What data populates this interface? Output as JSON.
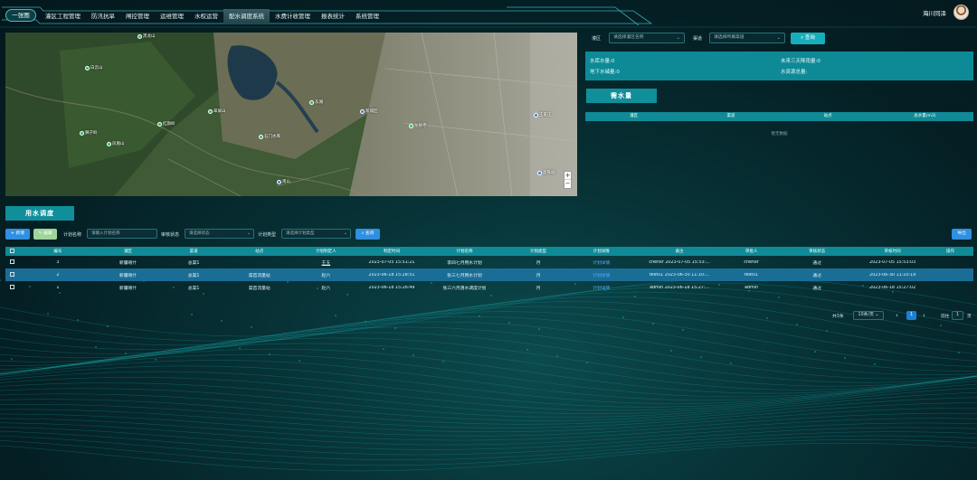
{
  "nav": {
    "home_label": "一张图",
    "items": [
      "灌区工程管理",
      "防汛抗旱",
      "闸控管理",
      "运维管理",
      "水权运营",
      "配水调度系统",
      "水费计收管理",
      "报表统计",
      "系统管理"
    ],
    "active_index": 5
  },
  "user": {
    "name": "海川同泽"
  },
  "map": {
    "labels": [
      "黑龙山",
      "白云山",
      "红旗岭",
      "狮子岭",
      "翠屏山",
      "凤凰山",
      "石门水库",
      "东湖",
      "新城区",
      "龙泉寺",
      "王家庄",
      "南山",
      "高铁站"
    ]
  },
  "filters": {
    "district_label": "灌区",
    "district_placeholder": "请选择灌区名称",
    "channel_label": "渠道",
    "channel_placeholder": "请选择所属渠道",
    "query_label": "查询"
  },
  "stats": {
    "reservoir": "水库水量:0",
    "rain3": "未来三天降雨量:0",
    "groundwater": "地下水储量:0",
    "total": "水资源总量:"
  },
  "demand": {
    "title": "需水量",
    "columns": [
      "灌区",
      "渠道",
      "站点",
      "总水量(m3)"
    ],
    "empty": "暂无数据"
  },
  "dispatch": {
    "title": "用水调度",
    "toolbar": {
      "add": "+ 新增",
      "edit": "✎ 编辑",
      "plan_name_label": "计划名称",
      "plan_name_placeholder": "请输入计划名称",
      "audit_label": "审核状态",
      "audit_placeholder": "请选择状态",
      "plan_type_label": "计划类型",
      "plan_type_placeholder": "请选择计划类型",
      "query": "查询",
      "export": "导出"
    },
    "columns": [
      "",
      "编号",
      "灌区",
      "渠道",
      "站点",
      "计划制定人",
      "制定时间",
      "计划名称",
      "计划类型",
      "计划详情",
      "备注",
      "审批人",
      "审核状态",
      "审核时间",
      "操作"
    ],
    "rows": [
      [
        "3",
        "新疆喀什",
        "总渠1",
        "",
        "王五",
        "2023-07-05 15:51:21",
        "李四七月用水计划",
        "月",
        "计划详情",
        "chenxr 2023-07-05 15:53:...",
        "chenxr",
        "通过",
        "2023-07-05 15:53:03",
        ""
      ],
      [
        "2",
        "新疆喀什",
        "总渠1",
        "渠首流量站",
        "赵六",
        "2023-06-18 15:28:51",
        "张三七月用水计划",
        "月",
        "计划详情",
        "test01 2023-06-30 11:10:...",
        "test01",
        "通过",
        "2023-06-30 11:10:19",
        ""
      ],
      [
        "1",
        "新疆喀什",
        "总渠1",
        "渠首流量站",
        "赵六",
        "2023-06-18 15:26:49",
        "张三六月用水调度计划",
        "月",
        "计划详情",
        "admin 2023-06-18 15:27:...",
        "admin",
        "通过",
        "2023-06-18 15:27:02",
        ""
      ]
    ],
    "selected_row": 1
  },
  "pagination": {
    "total": "共3条",
    "page_size": "10条/页",
    "prev": "‹",
    "current": "1",
    "next": "›",
    "goto_label": "前往",
    "goto_value": "1",
    "page_suffix": "页"
  }
}
